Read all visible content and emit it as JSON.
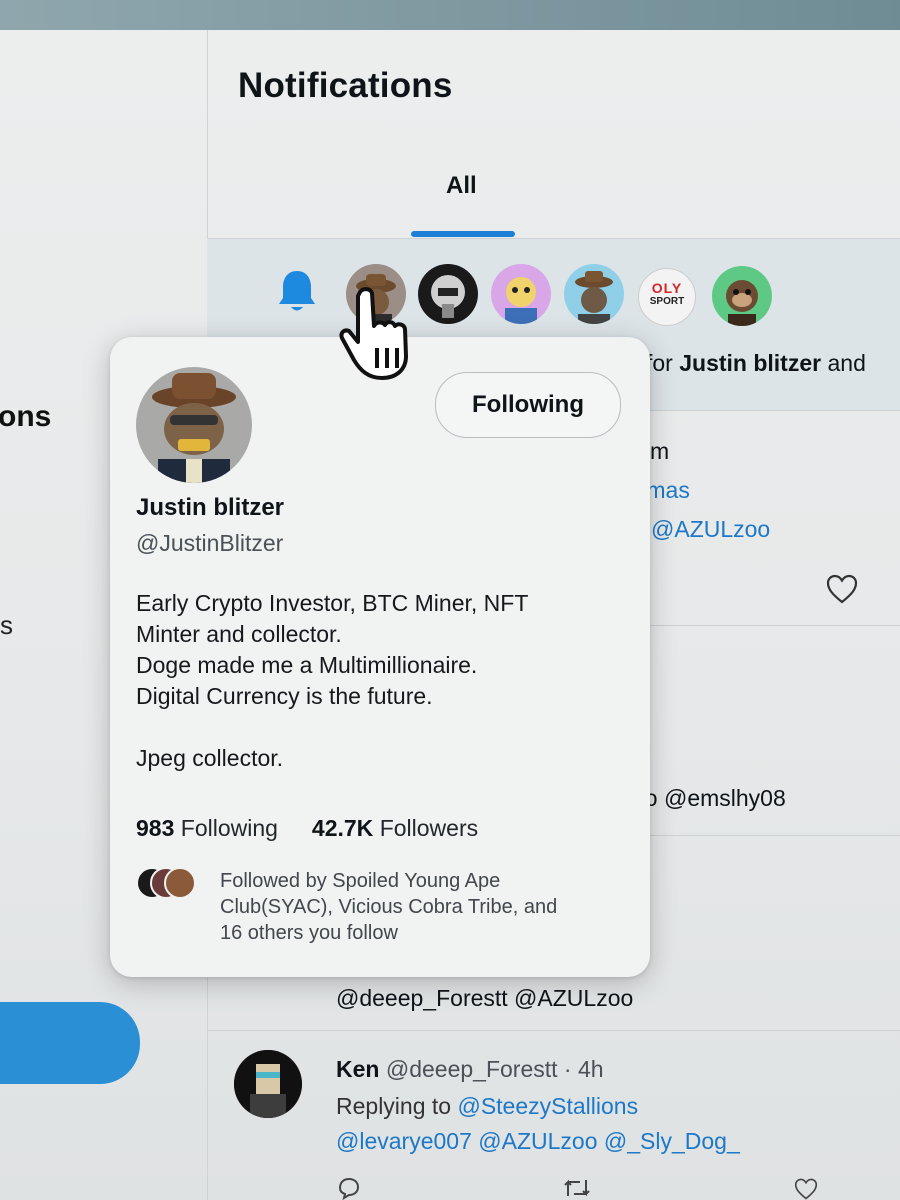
{
  "header": {
    "title": "Notifications"
  },
  "tabs": [
    {
      "label": "All",
      "active": true
    }
  ],
  "left_sidebar": {
    "fragment_1": "ons",
    "fragment_2": "s"
  },
  "notification": {
    "icon": "bell-icon",
    "avatars": [
      "ape-cowboy-avatar",
      "helmet-avatar",
      "cartoon-pink-avatar",
      "ape-cowboy-avatar-2",
      "oly-sport-logo",
      "monkey-avatar"
    ],
    "oly_logo_text_1": "OLY",
    "oly_logo_text_2": "SPORT",
    "text_prefix": "for ",
    "text_name": "Justin blitzer",
    "text_suffix": " and"
  },
  "background_fragments": {
    "f1": "m",
    "f2": "tmas",
    "f3": "@AZULzoo",
    "f4": "oo @emslhy08",
    "f5": "@deeep_Forestt @AZULzoo"
  },
  "hover_card": {
    "name": "Justin blitzer",
    "handle": "@JustinBlitzer",
    "follow_button": "Following",
    "bio_lines": [
      "Early Crypto Investor, BTC Miner, NFT",
      "Minter and collector.",
      "Doge made me a Multimillionaire.",
      "Digital Currency is the future.",
      "",
      "Jpeg collector."
    ],
    "following_count": "983",
    "following_label": "Following",
    "followers_count": "42.7K",
    "followers_label": "Followers",
    "followed_by_lines": [
      "Followed by Spoiled Young Ape",
      "Club(SYAC), Vicious Cobra Tribe, and",
      "16 others you follow"
    ]
  },
  "reply_tweet": {
    "author": "Ken",
    "handle_time": "@deeep_Forestt · 4h",
    "replying_to_label": "Replying to ",
    "replying_to_user": "@SteezyStallions",
    "mentions": "@levarye007 @AZULzoo @_Sly_Dog_"
  },
  "colors": {
    "accent": "#1d7fd6",
    "link": "#1d78c8",
    "notif_band": "#dde4e8"
  }
}
